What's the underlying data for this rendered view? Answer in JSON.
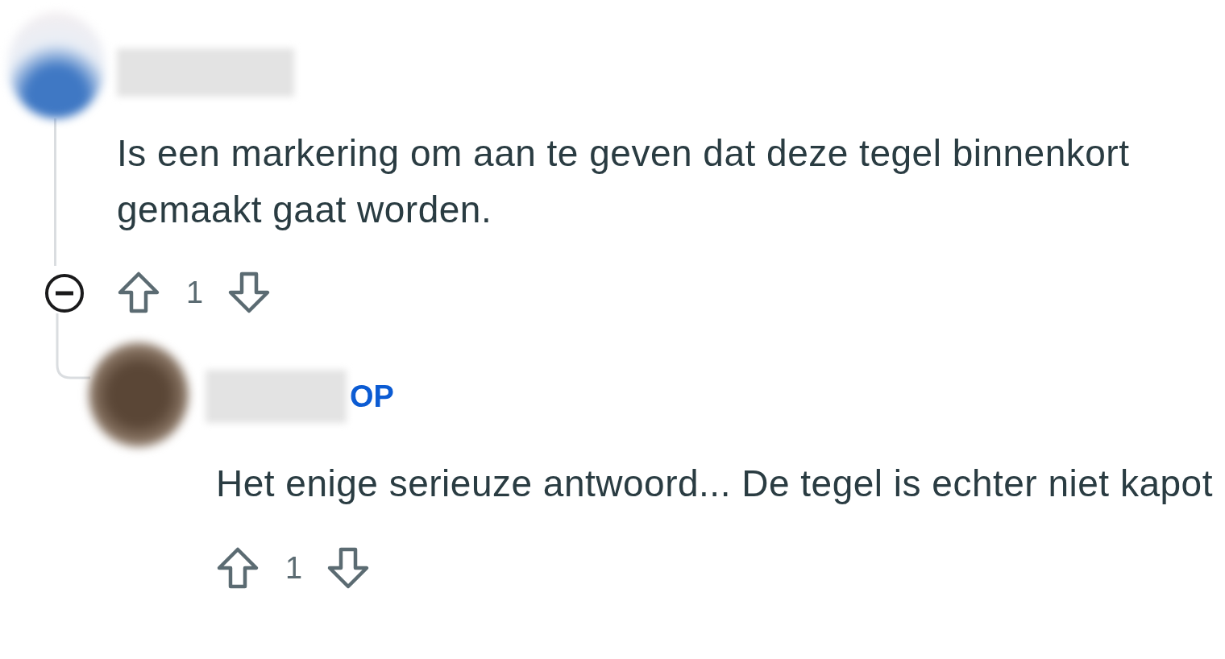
{
  "comments": [
    {
      "body": "Is een markering om aan te geven dat deze tegel binnenkort gemaakt gaat worden.",
      "votes": "1",
      "expanded": true,
      "children": [
        {
          "body": "Het enige serieuze antwoord...  De tegel is echter niet kapot",
          "votes": "1",
          "op_badge": "OP"
        }
      ]
    }
  ]
}
